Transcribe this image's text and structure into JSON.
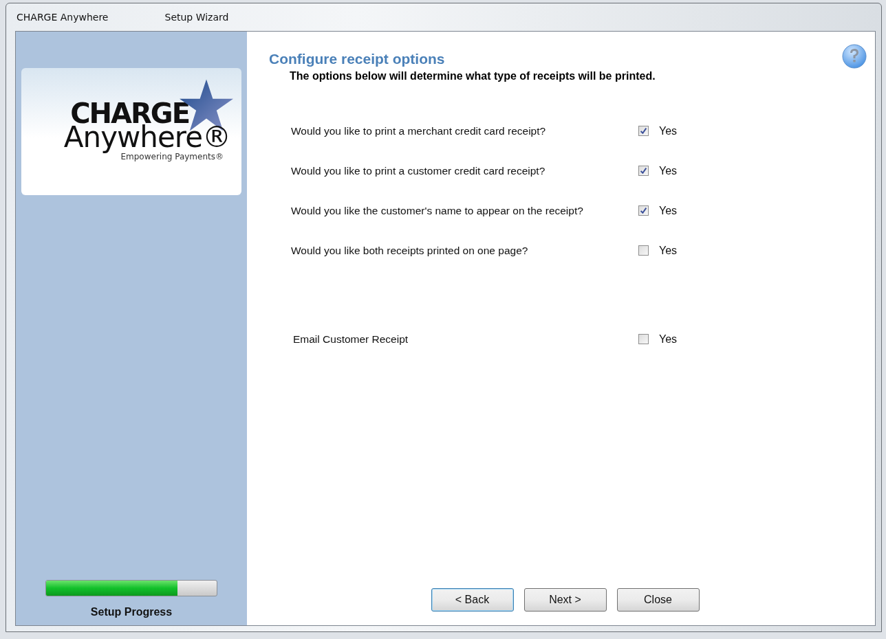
{
  "window": {
    "title": "CHARGE Anywhere",
    "subtitle": "Setup Wizard"
  },
  "logo": {
    "line_1": "CHARGE",
    "line_2": "Anywhere®",
    "tagline": "Empowering Payments®"
  },
  "progress": {
    "level": 0.77,
    "label": "Setup Progress"
  },
  "page": {
    "title": "Configure receipt options",
    "intro": "The options below will determine what type of receipts will be printed."
  },
  "receipt_options": [
    {
      "question": "Would you like to print a merchant credit card receipt?",
      "option": "Yes",
      "checked": true
    },
    {
      "question": "Would you like to print a customer credit card receipt?",
      "option": "Yes",
      "checked": true
    },
    {
      "question": "Would you like the customer's name to appear on the receipt?",
      "option": "Yes",
      "checked": true
    },
    {
      "question": "Would you like both receipts printed on one page?",
      "option": "Yes",
      "checked": false
    }
  ],
  "email_options": [
    {
      "question": "Email Customer Receipt",
      "option": "Yes",
      "checked": false
    }
  ],
  "buttons": [
    {
      "label": "< Back",
      "focused": true
    },
    {
      "label": "Next >",
      "focused": false
    },
    {
      "label": "Close",
      "focused": false
    }
  ]
}
